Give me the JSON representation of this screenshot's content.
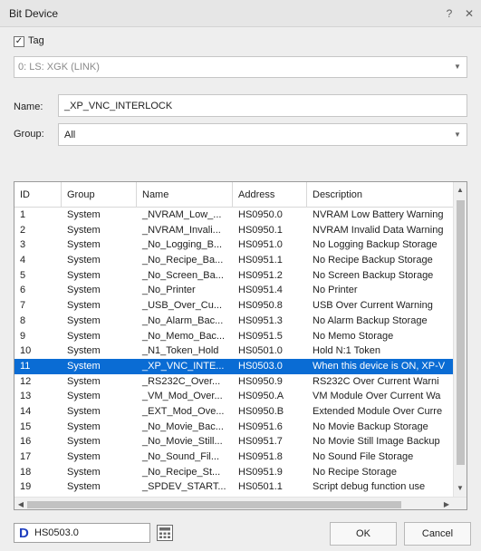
{
  "window": {
    "title": "Bit Device",
    "help_label": "?",
    "close_label": "✕"
  },
  "tag": {
    "checkbox_label": "Tag",
    "checked_mark": "✓",
    "plc_value": "0: LS: XGK (LINK)"
  },
  "name": {
    "label": "Name:",
    "value": "_XP_VNC_INTERLOCK"
  },
  "group": {
    "label": "Group:",
    "value": "All"
  },
  "table": {
    "columns": [
      "ID",
      "Group",
      "Name",
      "Address",
      "Description"
    ],
    "selected_index": 10,
    "rows": [
      {
        "id": "1",
        "group": "System",
        "name": "_NVRAM_Low_...",
        "address": "HS0950.0",
        "description": "NVRAM Low Battery Warning"
      },
      {
        "id": "2",
        "group": "System",
        "name": "_NVRAM_Invali...",
        "address": "HS0950.1",
        "description": "NVRAM Invalid Data Warning"
      },
      {
        "id": "3",
        "group": "System",
        "name": "_No_Logging_B...",
        "address": "HS0951.0",
        "description": "No Logging Backup Storage"
      },
      {
        "id": "4",
        "group": "System",
        "name": "_No_Recipe_Ba...",
        "address": "HS0951.1",
        "description": "No Recipe Backup Storage"
      },
      {
        "id": "5",
        "group": "System",
        "name": "_No_Screen_Ba...",
        "address": "HS0951.2",
        "description": "No Screen Backup Storage"
      },
      {
        "id": "6",
        "group": "System",
        "name": "_No_Printer",
        "address": "HS0951.4",
        "description": "No Printer"
      },
      {
        "id": "7",
        "group": "System",
        "name": "_USB_Over_Cu...",
        "address": "HS0950.8",
        "description": "USB Over Current Warning"
      },
      {
        "id": "8",
        "group": "System",
        "name": "_No_Alarm_Bac...",
        "address": "HS0951.3",
        "description": "No Alarm Backup Storage"
      },
      {
        "id": "9",
        "group": "System",
        "name": "_No_Memo_Bac...",
        "address": "HS0951.5",
        "description": "No Memo Storage"
      },
      {
        "id": "10",
        "group": "System",
        "name": "_N1_Token_Hold",
        "address": "HS0501.0",
        "description": "Hold N:1 Token"
      },
      {
        "id": "11",
        "group": "System",
        "name": "_XP_VNC_INTE...",
        "address": "HS0503.0",
        "description": "When this device is ON, XP-V"
      },
      {
        "id": "12",
        "group": "System",
        "name": "_RS232C_Over...",
        "address": "HS0950.9",
        "description": "RS232C Over Current Warni"
      },
      {
        "id": "13",
        "group": "System",
        "name": "_VM_Mod_Over...",
        "address": "HS0950.A",
        "description": "VM Module Over Current Wa"
      },
      {
        "id": "14",
        "group": "System",
        "name": "_EXT_Mod_Ove...",
        "address": "HS0950.B",
        "description": "Extended Module Over Curre"
      },
      {
        "id": "15",
        "group": "System",
        "name": "_No_Movie_Bac...",
        "address": "HS0951.6",
        "description": "No Movie Backup Storage"
      },
      {
        "id": "16",
        "group": "System",
        "name": "_No_Movie_Still...",
        "address": "HS0951.7",
        "description": "No Movie Still Image Backup"
      },
      {
        "id": "17",
        "group": "System",
        "name": "_No_Sound_Fil...",
        "address": "HS0951.8",
        "description": "No Sound File Storage"
      },
      {
        "id": "18",
        "group": "System",
        "name": "_No_Recipe_St...",
        "address": "HS0951.9",
        "description": "No Recipe Storage"
      },
      {
        "id": "19",
        "group": "System",
        "name": "_SPDEV_START...",
        "address": "HS0501.1",
        "description": "Script debug function use"
      }
    ]
  },
  "footer": {
    "device_letter": "D",
    "device_address": "HS0503.0",
    "ok_label": "OK",
    "cancel_label": "Cancel"
  },
  "colors": {
    "selection": "#0a6cd4",
    "device_letter": "#1f3fbf"
  }
}
